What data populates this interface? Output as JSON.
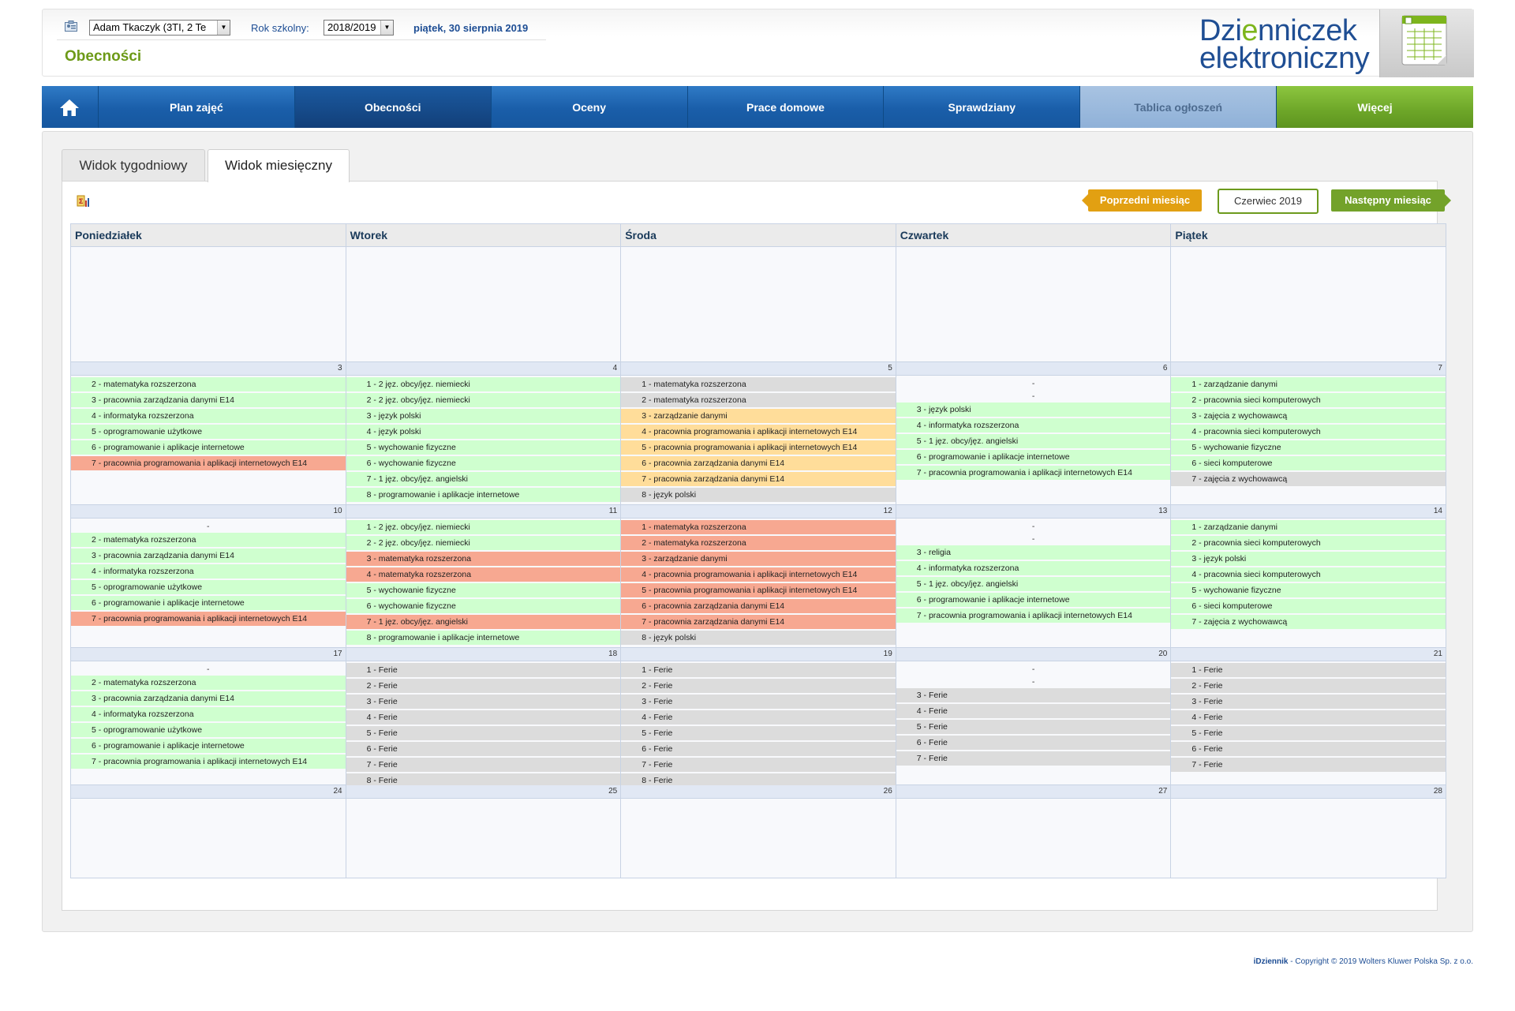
{
  "header": {
    "student_select": "Adam Tkaczyk (3TI, 2 Te",
    "year_label": "Rok szkolny:",
    "year_select": "2018/2019",
    "date": "piątek, 30 sierpnia 2019",
    "page_title": "Obecności",
    "logo_line1_a": "Dzi",
    "logo_line1_b": "e",
    "logo_line1_c": "nniczek",
    "logo_line2": "elektroniczny"
  },
  "nav": {
    "home_icon": "home-icon",
    "items": [
      "Plan zajęć",
      "Obecności",
      "Oceny",
      "Prace domowe",
      "Sprawdziany",
      "Tablica ogłoszeń",
      "Więcej"
    ]
  },
  "tabs": {
    "week": "Widok tygodniowy",
    "month": "Widok miesięczny"
  },
  "toolbar": {
    "export_icon": "export-icon",
    "prev": "Poprzedni miesiąc",
    "month": "Czerwiec 2019",
    "next": "Następny miesiąc"
  },
  "colors": {
    "present": "#cfffcf",
    "absent": "#f7a891",
    "late": "#ffdd9a",
    "free": "#dcdcdc",
    "nav_blue": "#1a5ea9",
    "nav_green": "#6da628",
    "title_green": "#6d9a18"
  },
  "calendar": {
    "days": [
      "Poniedziałek",
      "Wtorek",
      "Środa",
      "Czwartek",
      "Piątek"
    ],
    "weeks": [
      [
        {
          "num": "",
          "dashes": 0,
          "lessons": []
        },
        {
          "num": "",
          "dashes": 0,
          "lessons": []
        },
        {
          "num": "",
          "dashes": 0,
          "lessons": []
        },
        {
          "num": "",
          "dashes": 0,
          "lessons": []
        },
        {
          "num": "",
          "dashes": 0,
          "lessons": []
        }
      ],
      [
        {
          "num": "3",
          "dashes": 0,
          "lessons": [
            {
              "t": "2 - matematyka rozszerzona",
              "s": "present"
            },
            {
              "t": "3 - pracownia zarządzania danymi E14",
              "s": "present"
            },
            {
              "t": "4 - informatyka rozszerzona",
              "s": "present"
            },
            {
              "t": "5 - oprogramowanie użytkowe",
              "s": "present"
            },
            {
              "t": "6 - programowanie i aplikacje internetowe",
              "s": "present"
            },
            {
              "t": "7 - pracownia programowania i aplikacji internetowych E14",
              "s": "absent"
            }
          ]
        },
        {
          "num": "4",
          "dashes": 0,
          "lessons": [
            {
              "t": "1 - 2 jęz. obcy/jęz. niemiecki",
              "s": "present"
            },
            {
              "t": "2 - 2 jęz. obcy/jęz. niemiecki",
              "s": "present"
            },
            {
              "t": "3 - język polski",
              "s": "present"
            },
            {
              "t": "4 - język polski",
              "s": "present"
            },
            {
              "t": "5 - wychowanie fizyczne",
              "s": "present"
            },
            {
              "t": "6 - wychowanie fizyczne",
              "s": "present"
            },
            {
              "t": "7 - 1 jęz. obcy/jęz. angielski",
              "s": "present"
            },
            {
              "t": "8 - programowanie i aplikacje internetowe",
              "s": "present"
            }
          ]
        },
        {
          "num": "5",
          "dashes": 0,
          "lessons": [
            {
              "t": "1 - matematyka rozszerzona",
              "s": "free"
            },
            {
              "t": "2 - matematyka rozszerzona",
              "s": "free"
            },
            {
              "t": "3 - zarządzanie danymi",
              "s": "late"
            },
            {
              "t": "4 - pracownia programowania i aplikacji internetowych E14",
              "s": "late"
            },
            {
              "t": "5 - pracownia programowania i aplikacji internetowych E14",
              "s": "late"
            },
            {
              "t": "6 - pracownia zarządzania danymi E14",
              "s": "late"
            },
            {
              "t": "7 - pracownia zarządzania danymi E14",
              "s": "late"
            },
            {
              "t": "8 - język polski",
              "s": "free"
            }
          ]
        },
        {
          "num": "6",
          "dashes": 2,
          "lessons": [
            {
              "t": "3 - język polski",
              "s": "present"
            },
            {
              "t": "4 - informatyka rozszerzona",
              "s": "present"
            },
            {
              "t": "5 - 1 jęz. obcy/jęz. angielski",
              "s": "present"
            },
            {
              "t": "6 - programowanie i aplikacje internetowe",
              "s": "present"
            },
            {
              "t": "7 - pracownia programowania i aplikacji internetowych E14",
              "s": "present"
            }
          ]
        },
        {
          "num": "7",
          "dashes": 0,
          "lessons": [
            {
              "t": "1 - zarządzanie danymi",
              "s": "present"
            },
            {
              "t": "2 - pracownia sieci komputerowych",
              "s": "present"
            },
            {
              "t": "3 - zajęcia z wychowawcą",
              "s": "present"
            },
            {
              "t": "4 - pracownia sieci komputerowych",
              "s": "present"
            },
            {
              "t": "5 - wychowanie fizyczne",
              "s": "present"
            },
            {
              "t": "6 - sieci komputerowe",
              "s": "present"
            },
            {
              "t": "7 - zajęcia z wychowawcą",
              "s": "free"
            }
          ]
        }
      ],
      [
        {
          "num": "10",
          "dashes": 1,
          "lessons": [
            {
              "t": "2 - matematyka rozszerzona",
              "s": "present"
            },
            {
              "t": "3 - pracownia zarządzania danymi E14",
              "s": "present"
            },
            {
              "t": "4 - informatyka rozszerzona",
              "s": "present"
            },
            {
              "t": "5 - oprogramowanie użytkowe",
              "s": "present"
            },
            {
              "t": "6 - programowanie i aplikacje internetowe",
              "s": "present"
            },
            {
              "t": "7 - pracownia programowania i aplikacji internetowych E14",
              "s": "absent"
            }
          ]
        },
        {
          "num": "11",
          "dashes": 0,
          "lessons": [
            {
              "t": "1 - 2 jęz. obcy/jęz. niemiecki",
              "s": "present"
            },
            {
              "t": "2 - 2 jęz. obcy/jęz. niemiecki",
              "s": "present"
            },
            {
              "t": "3 - matematyka rozszerzona",
              "s": "absent"
            },
            {
              "t": "4 - matematyka rozszerzona",
              "s": "absent"
            },
            {
              "t": "5 - wychowanie fizyczne",
              "s": "present"
            },
            {
              "t": "6 - wychowanie fizyczne",
              "s": "present"
            },
            {
              "t": "7 - 1 jęz. obcy/jęz. angielski",
              "s": "absent"
            },
            {
              "t": "8 - programowanie i aplikacje internetowe",
              "s": "present"
            }
          ]
        },
        {
          "num": "12",
          "dashes": 0,
          "lessons": [
            {
              "t": "1 - matematyka rozszerzona",
              "s": "absent"
            },
            {
              "t": "2 - matematyka rozszerzona",
              "s": "absent"
            },
            {
              "t": "3 - zarządzanie danymi",
              "s": "absent"
            },
            {
              "t": "4 - pracownia programowania i aplikacji internetowych E14",
              "s": "absent"
            },
            {
              "t": "5 - pracownia programowania i aplikacji internetowych E14",
              "s": "absent"
            },
            {
              "t": "6 - pracownia zarządzania danymi E14",
              "s": "absent"
            },
            {
              "t": "7 - pracownia zarządzania danymi E14",
              "s": "absent"
            },
            {
              "t": "8 - język polski",
              "s": "free"
            }
          ]
        },
        {
          "num": "13",
          "dashes": 2,
          "lessons": [
            {
              "t": "3 - religia",
              "s": "present"
            },
            {
              "t": "4 - informatyka rozszerzona",
              "s": "present"
            },
            {
              "t": "5 - 1 jęz. obcy/jęz. angielski",
              "s": "present"
            },
            {
              "t": "6 - programowanie i aplikacje internetowe",
              "s": "present"
            },
            {
              "t": "7 - pracownia programowania i aplikacji internetowych E14",
              "s": "present"
            }
          ]
        },
        {
          "num": "14",
          "dashes": 0,
          "lessons": [
            {
              "t": "1 - zarządzanie danymi",
              "s": "present"
            },
            {
              "t": "2 - pracownia sieci komputerowych",
              "s": "present"
            },
            {
              "t": "3 - język polski",
              "s": "present"
            },
            {
              "t": "4 - pracownia sieci komputerowych",
              "s": "present"
            },
            {
              "t": "5 - wychowanie fizyczne",
              "s": "present"
            },
            {
              "t": "6 - sieci komputerowe",
              "s": "present"
            },
            {
              "t": "7 - zajęcia z wychowawcą",
              "s": "present"
            }
          ]
        }
      ],
      [
        {
          "num": "17",
          "dashes": 1,
          "lessons": [
            {
              "t": "2 - matematyka rozszerzona",
              "s": "present"
            },
            {
              "t": "3 - pracownia zarządzania danymi E14",
              "s": "present"
            },
            {
              "t": "4 - informatyka rozszerzona",
              "s": "present"
            },
            {
              "t": "5 - oprogramowanie użytkowe",
              "s": "present"
            },
            {
              "t": "6 - programowanie i aplikacje internetowe",
              "s": "present"
            },
            {
              "t": "7 - pracownia programowania i aplikacji internetowych E14",
              "s": "present"
            }
          ]
        },
        {
          "num": "18",
          "dashes": 0,
          "lessons": [
            {
              "t": "1 - Ferie",
              "s": "free"
            },
            {
              "t": "2 - Ferie",
              "s": "free"
            },
            {
              "t": "3 - Ferie",
              "s": "free"
            },
            {
              "t": "4 - Ferie",
              "s": "free"
            },
            {
              "t": "5 - Ferie",
              "s": "free"
            },
            {
              "t": "6 - Ferie",
              "s": "free"
            },
            {
              "t": "7 - Ferie",
              "s": "free"
            },
            {
              "t": "8 - Ferie",
              "s": "free"
            }
          ]
        },
        {
          "num": "19",
          "dashes": 0,
          "lessons": [
            {
              "t": "1 - Ferie",
              "s": "free"
            },
            {
              "t": "2 - Ferie",
              "s": "free"
            },
            {
              "t": "3 - Ferie",
              "s": "free"
            },
            {
              "t": "4 - Ferie",
              "s": "free"
            },
            {
              "t": "5 - Ferie",
              "s": "free"
            },
            {
              "t": "6 - Ferie",
              "s": "free"
            },
            {
              "t": "7 - Ferie",
              "s": "free"
            },
            {
              "t": "8 - Ferie",
              "s": "free"
            }
          ]
        },
        {
          "num": "20",
          "dashes": 2,
          "lessons": [
            {
              "t": "3 - Ferie",
              "s": "free"
            },
            {
              "t": "4 - Ferie",
              "s": "free"
            },
            {
              "t": "5 - Ferie",
              "s": "free"
            },
            {
              "t": "6 - Ferie",
              "s": "free"
            },
            {
              "t": "7 - Ferie",
              "s": "free"
            }
          ]
        },
        {
          "num": "21",
          "dashes": 0,
          "lessons": [
            {
              "t": "1 - Ferie",
              "s": "free"
            },
            {
              "t": "2 - Ferie",
              "s": "free"
            },
            {
              "t": "3 - Ferie",
              "s": "free"
            },
            {
              "t": "4 - Ferie",
              "s": "free"
            },
            {
              "t": "5 - Ferie",
              "s": "free"
            },
            {
              "t": "6 - Ferie",
              "s": "free"
            },
            {
              "t": "7 - Ferie",
              "s": "free"
            }
          ]
        }
      ],
      [
        {
          "num": "24",
          "dashes": 0,
          "lessons": []
        },
        {
          "num": "25",
          "dashes": 0,
          "lessons": []
        },
        {
          "num": "26",
          "dashes": 0,
          "lessons": []
        },
        {
          "num": "27",
          "dashes": 0,
          "lessons": []
        },
        {
          "num": "28",
          "dashes": 0,
          "lessons": []
        }
      ]
    ]
  },
  "footer": {
    "brand": "iDziennik",
    "copyright": " - Copyright © 2019 Wolters Kluwer Polska Sp. z o.o."
  }
}
